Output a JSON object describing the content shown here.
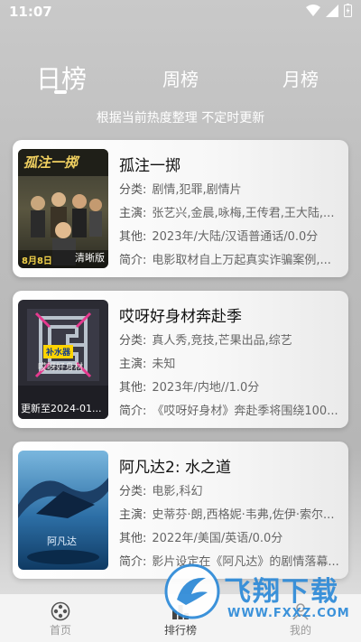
{
  "status": {
    "time": "11:07"
  },
  "tabs": {
    "day": "日榜",
    "week": "周榜",
    "month": "月榜"
  },
  "subtitle": "根据当前热度整理 不定时更新",
  "labels": {
    "category": "分类:",
    "cast": "主演:",
    "other": "其他:",
    "intro": "简介:"
  },
  "items": [
    {
      "title": "孤注一掷",
      "category": "剧情,犯罪,剧情片",
      "cast": "张艺兴,金晨,咏梅,王传君,王大陆,...",
      "other": "2023年/大陆/汉语普通话/0.0分",
      "intro": "电影取材自上万起真实诈骗案例,...",
      "poster_badge": "清晰版",
      "poster_title": "孤注一掷",
      "poster_date": "8月8日"
    },
    {
      "title": "哎呀好身材奔赴季",
      "category": "真人秀,竞技,芒果出品,综艺",
      "cast": "未知",
      "other": "2023年/内地//1.0分",
      "intro": "《哎呀好身材》奔赴季将围绕100...",
      "poster_badge": "更新至2024-01...",
      "poster_title": "哎呀好身材",
      "poster_tag": "补水器"
    },
    {
      "title": "阿凡达2: 水之道",
      "category": "电影,科幻",
      "cast": "史蒂芬·朗,西格妮·韦弗,佐伊·索尔...",
      "other": "2022年/美国/英语/0.0分",
      "intro": "影片设定在《阿凡达》的剧情落幕...",
      "poster_title": "阿凡达"
    }
  ],
  "nav": {
    "home": "首页",
    "rank": "排行榜",
    "me": "我的"
  },
  "watermark": {
    "brand": "飞翔下载",
    "url": "WWW.FXXZ.COM"
  }
}
